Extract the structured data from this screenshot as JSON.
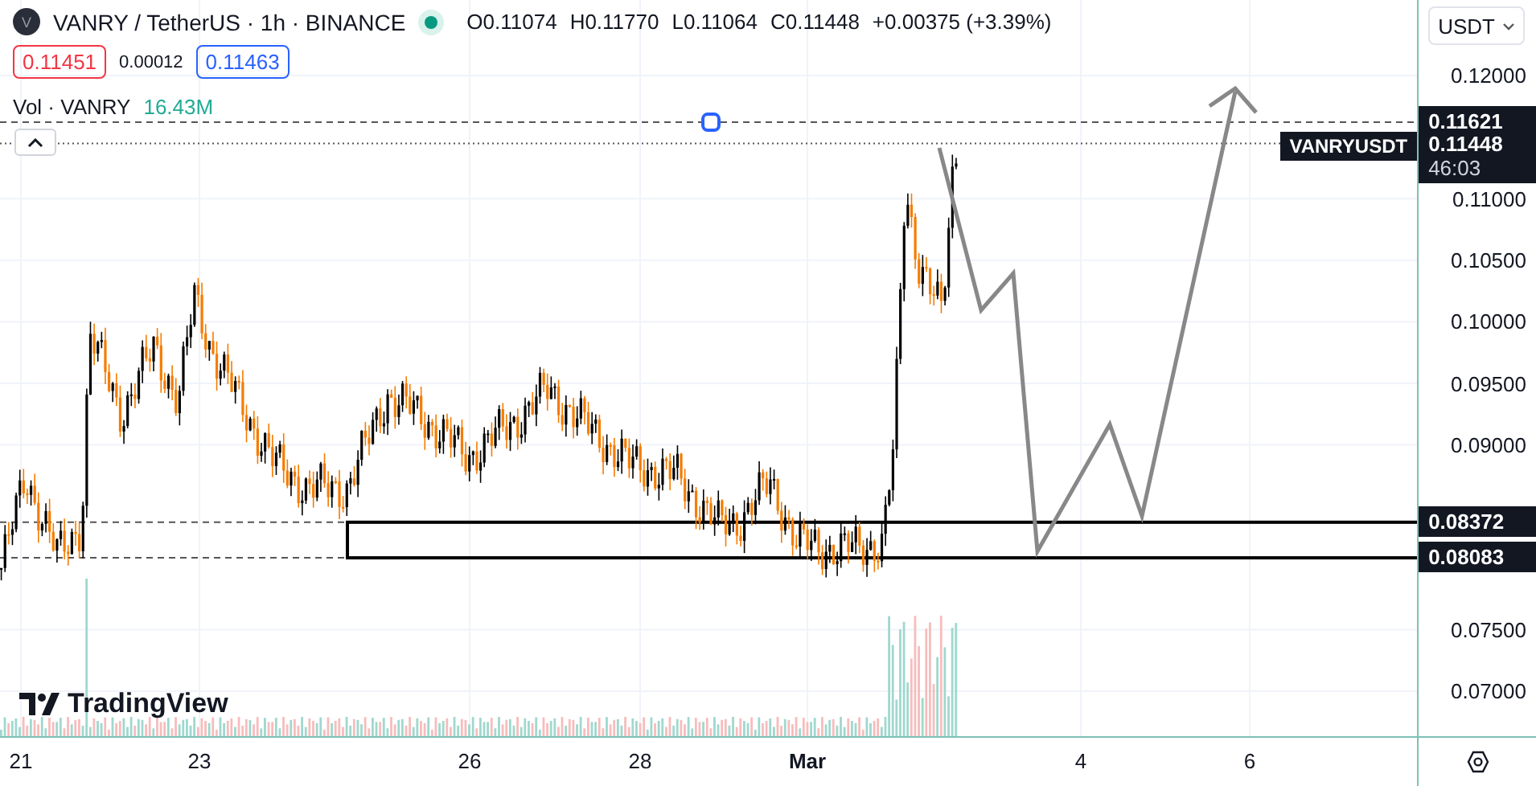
{
  "header": {
    "symbol_initial": "V",
    "title": "VANRY / TetherUS · 1h · BINANCE",
    "market_open": true,
    "ohlc": [
      {
        "label": "O",
        "value": "0.11074"
      },
      {
        "label": "H",
        "value": "0.11770"
      },
      {
        "label": "L",
        "value": "0.11064"
      },
      {
        "label": "C",
        "value": "0.11448"
      }
    ],
    "change": "+0.00375 (+3.39%)"
  },
  "quote": {
    "bid": "0.11451",
    "spread": "0.00012",
    "ask": "0.11463"
  },
  "volume": {
    "label": "Vol · VANRY",
    "value": "16.43M"
  },
  "logo": "TradingView",
  "price_axis": {
    "currency": "USDT",
    "ticks": [
      "0.12000",
      "0.11000",
      "0.10500",
      "0.10000",
      "0.09500",
      "0.09000",
      "0.07500",
      "0.07000"
    ]
  },
  "price_tags": [
    {
      "kind": "line",
      "value": "0.11621"
    },
    {
      "kind": "last",
      "symbol": "VANRYUSDT",
      "value": "0.11448",
      "countdown": "46:03"
    },
    {
      "kind": "level",
      "value": "0.08372"
    },
    {
      "kind": "level",
      "value": "0.08083"
    }
  ],
  "time_axis": [
    {
      "label": "21",
      "kind": "day"
    },
    {
      "label": "23",
      "kind": "day"
    },
    {
      "label": "26",
      "kind": "day"
    },
    {
      "label": "28",
      "kind": "day"
    },
    {
      "label": "Mar",
      "kind": "month"
    },
    {
      "label": "4",
      "kind": "day"
    },
    {
      "label": "6",
      "kind": "day"
    }
  ]
}
